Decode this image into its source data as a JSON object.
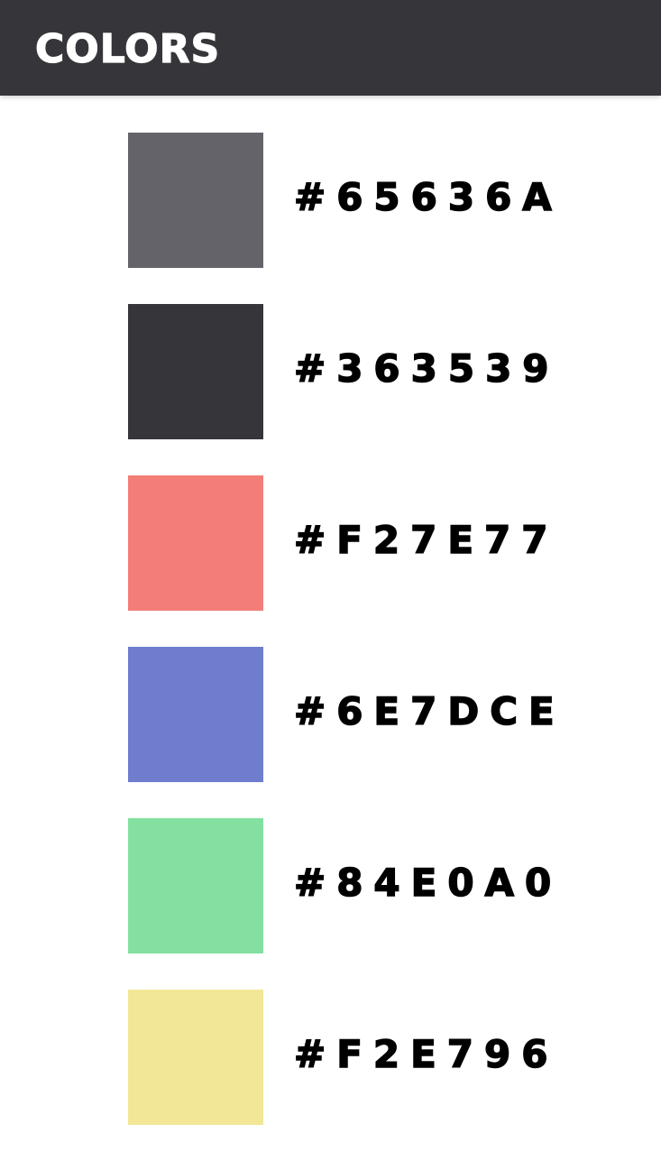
{
  "header": {
    "title": "COLORS",
    "background": "#363539"
  },
  "palette": [
    {
      "label": "#65636A",
      "hex": "#65636A"
    },
    {
      "label": "#363539",
      "hex": "#363539"
    },
    {
      "label": "#F27E77",
      "hex": "#F27E77"
    },
    {
      "label": "#6E7DCE",
      "hex": "#6E7DCE"
    },
    {
      "label": "#84E0A0",
      "hex": "#84E0A0"
    },
    {
      "label": "#F2E796",
      "hex": "#F2E796"
    }
  ]
}
